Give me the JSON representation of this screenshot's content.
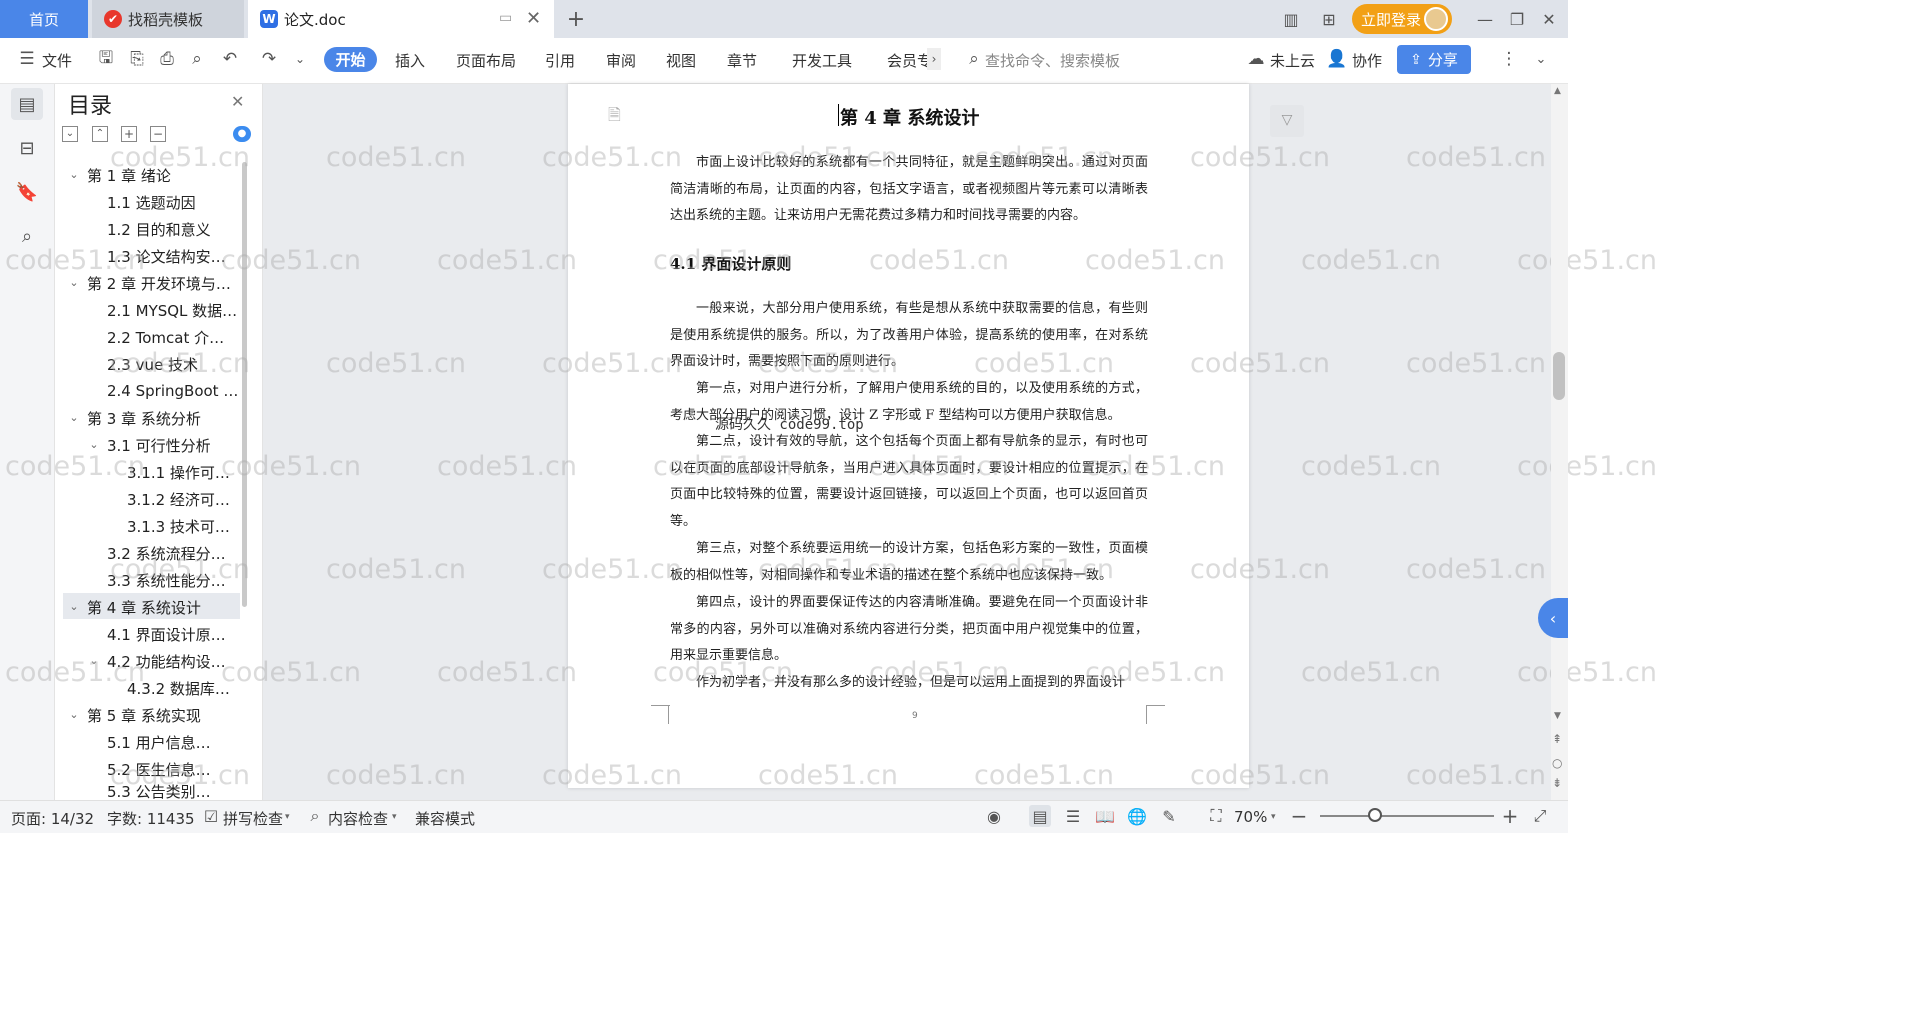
{
  "tabs": {
    "home": "首页",
    "daoke": "找稻壳模板",
    "doc": "论文.doc"
  },
  "topright": {
    "login": "立即登录"
  },
  "toolbar": {
    "file": "文件",
    "tabs": [
      "开始",
      "插入",
      "页面布局",
      "引用",
      "审阅",
      "视图",
      "章节",
      "开发工具",
      "会员专"
    ],
    "search_placeholder": "查找命令、搜索模板",
    "cloud": "未上云",
    "collab": "协作",
    "share": "分享"
  },
  "toc": {
    "title": "目录",
    "items": [
      {
        "label": "第 1 章  绪论",
        "level": 0
      },
      {
        "label": "1.1 选题动因",
        "level": 1
      },
      {
        "label": "1.2 目的和意义",
        "level": 1
      },
      {
        "label": "1.3 论文结构安…",
        "level": 1
      },
      {
        "label": "第 2 章  开发环境与…",
        "level": 0
      },
      {
        "label": "2.1 MYSQL 数据…",
        "level": 1
      },
      {
        "label": "2.2 Tomcat  介…",
        "level": 1
      },
      {
        "label": "2.3 vue 技术",
        "level": 1
      },
      {
        "label": "2.4 SpringBoot …",
        "level": 1
      },
      {
        "label": "第 3 章  系统分析",
        "level": 0
      },
      {
        "label": "3.1 可行性分析",
        "level": 1
      },
      {
        "label": "3.1.1 操作可…",
        "level": 2
      },
      {
        "label": "3.1.2 经济可…",
        "level": 2
      },
      {
        "label": "3.1.3 技术可…",
        "level": 2
      },
      {
        "label": "3.2 系统流程分…",
        "level": 1
      },
      {
        "label": "3.3 系统性能分…",
        "level": 1
      },
      {
        "label": "第 4 章  系统设计",
        "level": 0
      },
      {
        "label": "4.1 界面设计原…",
        "level": 1
      },
      {
        "label": "4.2 功能结构设…",
        "level": 1
      },
      {
        "label": "4.3.2  数据库…",
        "level": 2
      },
      {
        "label": "第 5 章  系统实现",
        "level": 0
      },
      {
        "label": "5.1 用户信息…",
        "level": 1
      },
      {
        "label": "5.2  医生信息…",
        "level": 1
      },
      {
        "label": "5.3 公告类别…",
        "level": 1
      }
    ]
  },
  "document": {
    "chapter_title": "第 4 章  系统设计",
    "intro": "市面上设计比较好的系统都有一个共同特征，就是主题鲜明突出。通过对页面简洁清晰的布局，让页面的内容，包括文字语言，或者视频图片等元素可以清晰表达出系统的主题。让来访用户无需花费过多精力和时间找寻需要的内容。",
    "section_title": "4.1 界面设计原则",
    "p1": "一般来说，大部分用户使用系统，有些是想从系统中获取需要的信息，有些则是使用系统提供的服务。所以，为了改善用户体验，提高系统的使用率，在对系统界面设计时，需要按照下面的原则进行。",
    "p2": "第一点，对用户进行分析，了解用户使用系统的目的，以及使用系统的方式，考虑大部分用户的阅读习惯，设计 Z 字形或 F 型结构可以方便用户获取信息。",
    "p3": "第二点，设计有效的导航，这个包括每个页面上都有导航条的显示，有时也可以在页面的底部设计导航条，当用户进入具体页面时，要设计相应的位置提示，在页面中比较特殊的位置，需要设计返回链接，可以返回上个页面，也可以返回首页等。",
    "p4": "第三点，对整个系统要运用统一的设计方案，包括色彩方案的一致性，页面模板的相似性等，对相同操作和专业术语的描述在整个系统中也应该保持一致。",
    "p5": "第四点，设计的界面要保证传达的内容清晰准确。要避免在同一个页面设计非常多的内容，另外可以准确对系统内容进行分类，把页面中用户视觉集中的位置，用来显示重要信息。",
    "p6": "作为初学者，并没有那么多的设计经验，但是可以运用上面提到的界面设计",
    "stamp": "源码久久 code99.top",
    "page_number": "9"
  },
  "watermark": "code51.cn",
  "status": {
    "page": "页面: 14/32",
    "words": "字数: 11435",
    "spell": "拼写检查",
    "content_check": "内容检查",
    "compat": "兼容模式",
    "zoom": "70%"
  },
  "colors": {
    "accent": "#4a86e8",
    "login": "#f2a016"
  }
}
